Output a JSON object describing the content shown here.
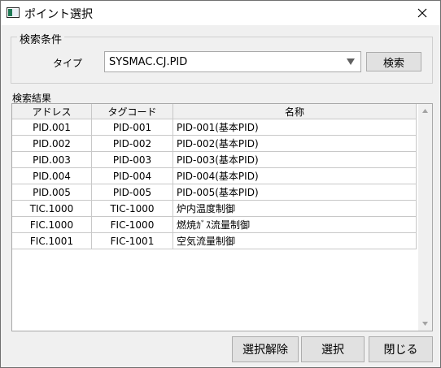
{
  "window": {
    "title": "ポイント選択"
  },
  "search": {
    "group_title": "検索条件",
    "type_label": "タイプ",
    "type_value": "SYSMAC.CJ.PID",
    "search_button": "検索"
  },
  "results": {
    "label": "検索結果",
    "columns": [
      "アドレス",
      "タグコード",
      "名称"
    ],
    "rows": [
      [
        "PID.001",
        "PID-001",
        "PID-001(基本PID)"
      ],
      [
        "PID.002",
        "PID-002",
        "PID-002(基本PID)"
      ],
      [
        "PID.003",
        "PID-003",
        "PID-003(基本PID)"
      ],
      [
        "PID.004",
        "PID-004",
        "PID-004(基本PID)"
      ],
      [
        "PID.005",
        "PID-005",
        "PID-005(基本PID)"
      ],
      [
        "TIC.1000",
        "TIC-1000",
        "炉内温度制御"
      ],
      [
        "FIC.1000",
        "FIC-1000",
        "燃焼ｶﾞｽ流量制御"
      ],
      [
        "FIC.1001",
        "FIC-1001",
        "空気流量制御"
      ]
    ]
  },
  "footer": {
    "deselect": "選択解除",
    "select": "選択",
    "close": "閉じる"
  },
  "icons": {
    "app": "window-icon",
    "close": "close-icon",
    "dropdown": "triangle-down-icon",
    "scroll_up": "triangle-up-icon",
    "scroll_down": "triangle-down-icon"
  }
}
